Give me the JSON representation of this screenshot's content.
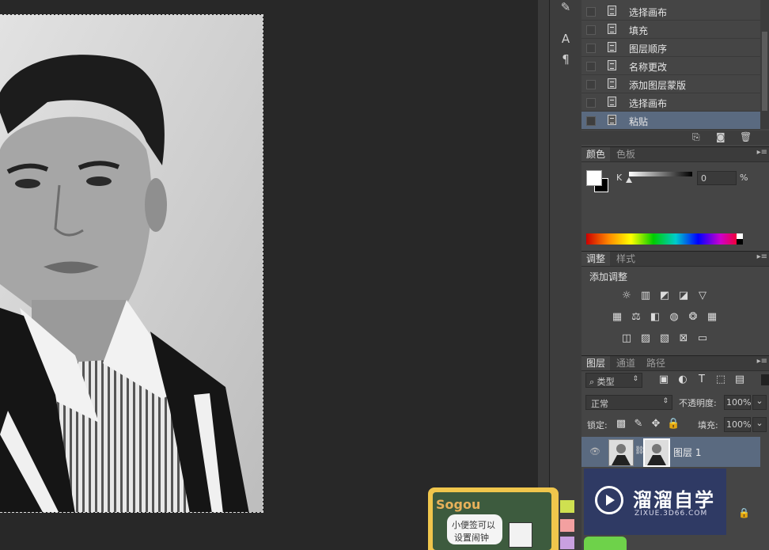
{
  "history": {
    "items": [
      {
        "label": "选择画布",
        "selected": false
      },
      {
        "label": "填充",
        "selected": false
      },
      {
        "label": "图层顺序",
        "selected": false
      },
      {
        "label": "名称更改",
        "selected": false
      },
      {
        "label": "添加图层蒙版",
        "selected": false
      },
      {
        "label": "选择画布",
        "selected": false
      },
      {
        "label": "粘贴",
        "selected": true
      }
    ]
  },
  "color_panel": {
    "tabs": [
      "颜色",
      "色板"
    ],
    "channel_label": "K",
    "value": "0",
    "unit": "%"
  },
  "adjust_panel": {
    "tabs": [
      "调整",
      "样式"
    ],
    "title": "添加调整"
  },
  "layers_panel": {
    "tabs": [
      "图层",
      "通道",
      "路径"
    ],
    "filter_kind": "类型",
    "blend_mode": "正常",
    "opacity_label": "不透明度:",
    "opacity_value": "100%",
    "lock_label": "锁定:",
    "fill_label": "填充:",
    "fill_value": "100%",
    "layers": [
      {
        "name": "图层 1"
      }
    ]
  },
  "sogou": {
    "logo": "Sogou",
    "note_line1": "小便签可以",
    "note_line2": "设置闹钟"
  },
  "watermark": {
    "title": "溜溜自学",
    "url": "ZIXUE.3D66.COM"
  },
  "colors": {
    "panel_bg": "#454545",
    "selection_bg": "#5a6a80",
    "canvas_bg": "#282828"
  }
}
